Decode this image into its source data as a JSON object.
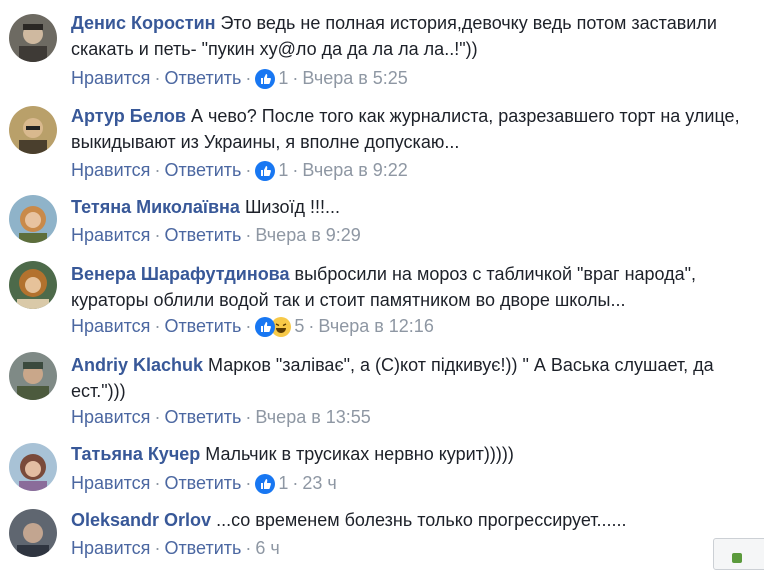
{
  "actions": {
    "like": "Нравится",
    "reply": "Ответить",
    "sep": "·"
  },
  "comments": [
    {
      "author": "Денис Коростин",
      "text": "Это ведь не полная история,девочку ведь потом заставили скакать и петь- \"пукин ху@ло да да ла ла ла..!\"))",
      "reactions": [
        "like"
      ],
      "count": "1",
      "time": "Вчера в 5:25"
    },
    {
      "author": "Артур Белов",
      "text": "А чево? После того как журналиста, разрезавшего торт на улице, выкидывают из Украины, я вполне допускаю...",
      "reactions": [
        "like"
      ],
      "count": "1",
      "time": "Вчера в 9:22"
    },
    {
      "author": "Тетяна Миколаївна",
      "text": "Шизоїд !!!...",
      "reactions": [],
      "count": "",
      "time": "Вчера в 9:29"
    },
    {
      "author": "Венера Шарафутдинова",
      "text": "выбросили на мороз с табличкой \"враг народа\", кураторы облили водой так и стоит памятником во дворе школы...",
      "reactions": [
        "like",
        "haha"
      ],
      "count": "5",
      "time": "Вчера в 12:16"
    },
    {
      "author": "Andriy Klachuk",
      "text": "Марков \"заліває\", а (С)кот підкивує!)) \" А Васька слушает, да ест.\")))",
      "reactions": [],
      "count": "",
      "time": "Вчера в 13:55"
    },
    {
      "author": "Татьяна Кучер",
      "text": "Мальчик в трусиках нервно курит)))))",
      "reactions": [
        "like"
      ],
      "count": "1",
      "time": "23 ч"
    },
    {
      "author": "Oleksandr Orlov",
      "text": "...со временем болезнь только прогрессирует......",
      "reactions": [],
      "count": "",
      "time": "6 ч"
    }
  ],
  "colors": {
    "author": "#385898",
    "link": "#4b67a1",
    "meta": "#8e97a3",
    "like": "#1877f2"
  }
}
